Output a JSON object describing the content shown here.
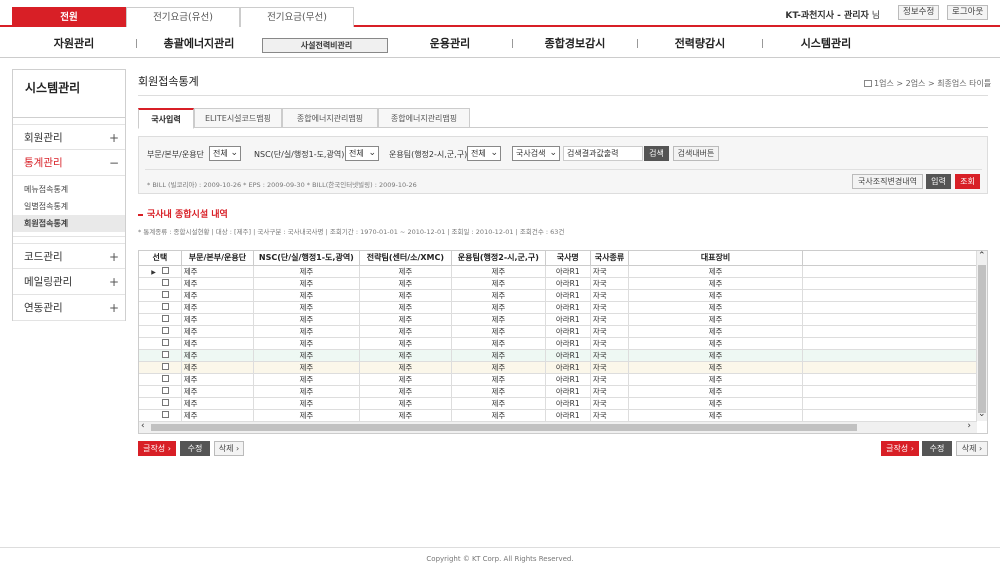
{
  "top_tabs": [
    "전원",
    "전기요금(유선)",
    "전기요금(무선)"
  ],
  "user": {
    "name": "KT-과천지사 - 관리자",
    "suffix": "님"
  },
  "top_buttons": [
    "정보수정",
    "로그아웃"
  ],
  "gnb": [
    "자원관리",
    "총괄에너지관리",
    "사설전력비관리",
    "운용관리",
    "종합경보감시",
    "전력량감시",
    "시스템관리"
  ],
  "lnb": {
    "title": "시스템관리",
    "items": [
      {
        "label": "회원관리",
        "toggle": "+"
      },
      {
        "label": "통계관리",
        "toggle": "−"
      }
    ],
    "subitems": [
      "메뉴접속통계",
      "일별접속통계",
      "회원접속통계"
    ],
    "items2": [
      {
        "label": "코드관리",
        "toggle": "+"
      },
      {
        "label": "메일링관리",
        "toggle": "+"
      },
      {
        "label": "연동관리",
        "toggle": "+"
      }
    ]
  },
  "page": {
    "title": "회원접속통계",
    "breadcrumb": "1업스 > 2업스 > 최종업스 타이틀"
  },
  "content_tabs": [
    "국사입력",
    "ELITE시설코드맵핑",
    "종합에너지관리맵핑",
    "종합에너지관리맵핑"
  ],
  "search": {
    "labels": [
      "부문/본부/운용단",
      "NSC(단/실/행정1-도,광역)",
      "운용팀(행정2-시,군,구)"
    ],
    "selects": [
      "전체",
      "전체",
      "전체",
      "국사검색"
    ],
    "result_input": "검색결과값출력",
    "search_button": "검색",
    "export_button": "검색내버튼",
    "note": "* BILL (빌코리아) : 2009-10-26 * EPS : 2009-09-30 * BILL(한국인터넷빌링) : 2009-10-26",
    "buttons": [
      "국사조직변경내역",
      "입력",
      "조회"
    ]
  },
  "section": {
    "title": "국사내 종합시설 내역",
    "note": "* 통계종류 : 종합시설현황 | 대상 : [제주] | 국사구분 : 국사내국사명 | 조회기간 : 1970-01-01 ~ 2010-12-01 | 조회일 : 2010-12-01 | 조회건수 : 63건"
  },
  "table": {
    "headers": [
      "선택",
      "부문/본부/운용단",
      "NSC(단/실/행정1-도,광역)",
      "전략팀(센터/소/XMC)",
      "운용팀(행정2-시,군,구)",
      "국사명",
      "국사종류",
      "대표장비"
    ],
    "rows": [
      [
        "제주",
        "제주",
        "제주",
        "제주",
        "아라R1",
        "자국",
        "제주"
      ],
      [
        "제주",
        "제주",
        "제주",
        "제주",
        "아라R1",
        "자국",
        "제주"
      ],
      [
        "제주",
        "제주",
        "제주",
        "제주",
        "아라R1",
        "자국",
        "제주"
      ],
      [
        "제주",
        "제주",
        "제주",
        "제주",
        "아라R1",
        "자국",
        "제주"
      ],
      [
        "제주",
        "제주",
        "제주",
        "제주",
        "아라R1",
        "자국",
        "제주"
      ],
      [
        "제주",
        "제주",
        "제주",
        "제주",
        "아라R1",
        "자국",
        "제주"
      ],
      [
        "제주",
        "제주",
        "제주",
        "제주",
        "아라R1",
        "자국",
        "제주"
      ],
      [
        "제주",
        "제주",
        "제주",
        "제주",
        "아라R1",
        "자국",
        "제주"
      ],
      [
        "제주",
        "제주",
        "제주",
        "제주",
        "아라R1",
        "자국",
        "제주"
      ],
      [
        "제주",
        "제주",
        "제주",
        "제주",
        "아라R1",
        "자국",
        "제주"
      ],
      [
        "제주",
        "제주",
        "제주",
        "제주",
        "아라R1",
        "자국",
        "제주"
      ],
      [
        "제주",
        "제주",
        "제주",
        "제주",
        "아라R1",
        "자국",
        "제주"
      ],
      [
        "제주",
        "제주",
        "제주",
        "제주",
        "아라R1",
        "자국",
        "제주"
      ]
    ]
  },
  "bottom_buttons": [
    "글작성 ›",
    "수정",
    "삭제 ›"
  ],
  "footer": "Copyright © KT Corp. All Rights Reserved.",
  "colors": {
    "accent": "#d81f26",
    "dark_button": "#555555"
  }
}
